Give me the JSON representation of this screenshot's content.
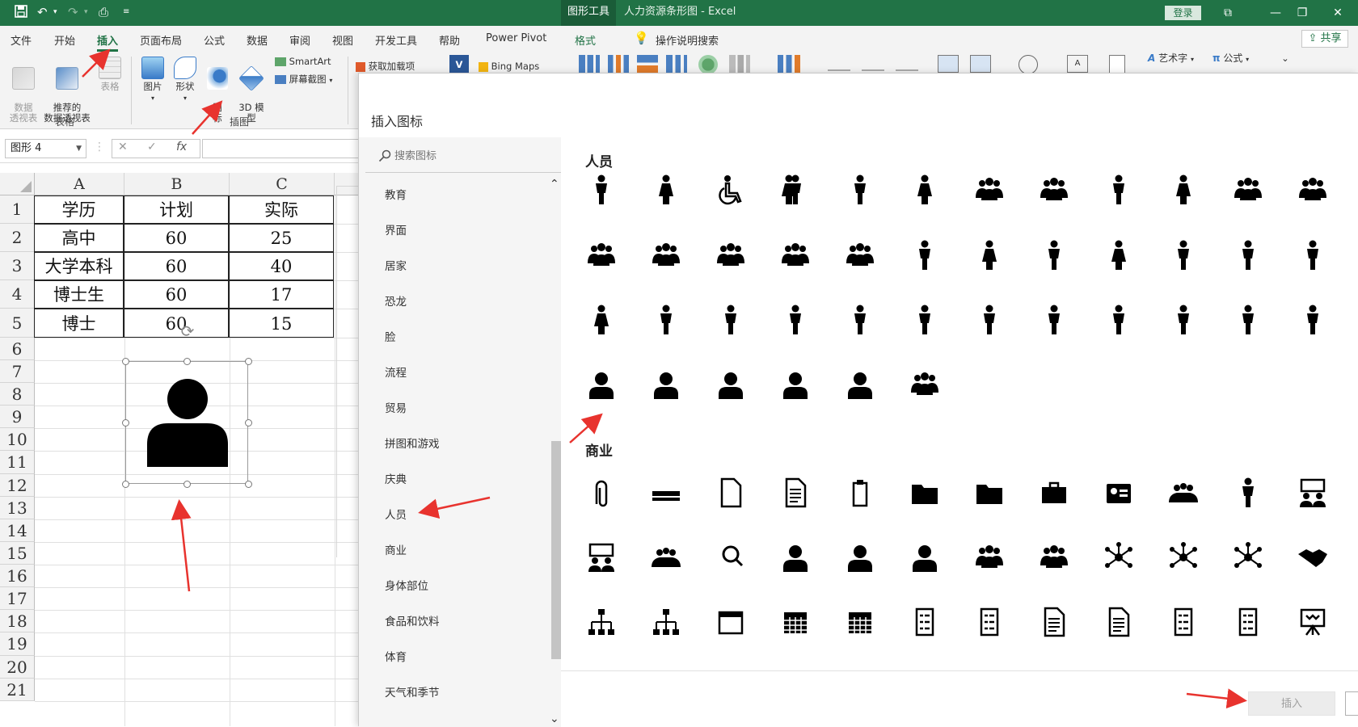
{
  "titlebar": {
    "tools_tab": "图形工具",
    "title": "人力资源条形图  -  Excel",
    "login": "登录"
  },
  "ribbon_tabs": [
    "文件",
    "开始",
    "插入",
    "页面布局",
    "公式",
    "数据",
    "审阅",
    "视图",
    "开发工具",
    "帮助",
    "Power Pivot",
    "格式",
    "操作说明搜索"
  ],
  "share": "共享",
  "ribbon": {
    "pivot_table": "数据\n透视表",
    "rec_pivot": "推荐的\n数据透视表",
    "table": "表格",
    "group_tables": "表格",
    "pictures": "图片",
    "shapes": "形状",
    "icons": "图\n标",
    "model3d": "3D 模\n型",
    "smartart": "SmartArt",
    "screenshot": "屏幕截图",
    "group_illustrations": "插图",
    "get_addins": "获取加载项",
    "bing_maps": "Bing Maps",
    "wordart": "艺术字",
    "equation": "公式"
  },
  "formula_bar": {
    "name_box": "图形 4",
    "formula": ""
  },
  "sheet": {
    "columns": [
      "A",
      "B",
      "C"
    ],
    "rows": [
      "1",
      "2",
      "3",
      "4",
      "5",
      "6",
      "7",
      "8",
      "9",
      "10",
      "11",
      "12",
      "13",
      "14",
      "15",
      "16",
      "17",
      "18",
      "19",
      "20",
      "21"
    ],
    "table": [
      [
        "学历",
        "计划",
        "实际"
      ],
      [
        "高中",
        "60",
        "25"
      ],
      [
        "大学本科",
        "60",
        "40"
      ],
      [
        "博士生",
        "60",
        "17"
      ],
      [
        "博士",
        "60",
        "15"
      ]
    ]
  },
  "dialog": {
    "title": "插入图标",
    "search_placeholder": "搜索图标",
    "categories": [
      "教育",
      "界面",
      "居家",
      "恐龙",
      "脸",
      "流程",
      "贸易",
      "拼图和游戏",
      "庆典",
      "人员",
      "商业",
      "身体部位",
      "食品和饮料",
      "体育",
      "天气和季节"
    ],
    "section_people": "人员",
    "section_business": "商业",
    "insert_button": "插入"
  },
  "colors": {
    "excel_green": "#217346",
    "arrow_red": "#e8332e"
  }
}
